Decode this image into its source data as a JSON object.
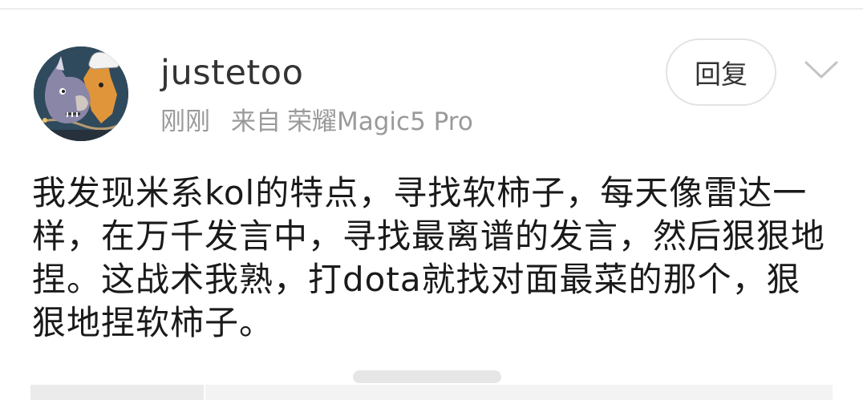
{
  "user": {
    "username": "justetoo",
    "time": "刚刚",
    "source_prefix": "来自",
    "device": "荣耀Magic5 Pro"
  },
  "actions": {
    "reply_label": "回复"
  },
  "post": {
    "text": "我发现米系kol的特点，寻找软柿子，每天像雷达一样，在万千发言中，寻找最离谱的发言，然后狠狠地捏。这战术我熟，打dota就找对面最菜的那个，狠狠地捏软柿子。"
  },
  "icons": {
    "avatar": "cartoon-rhino-chef-avatar",
    "menu": "chevron-down-icon"
  },
  "colors": {
    "username": "#333333",
    "meta": "#9a9a9a",
    "body": "#1a1a1a",
    "button_border": "#e3e3e3"
  }
}
